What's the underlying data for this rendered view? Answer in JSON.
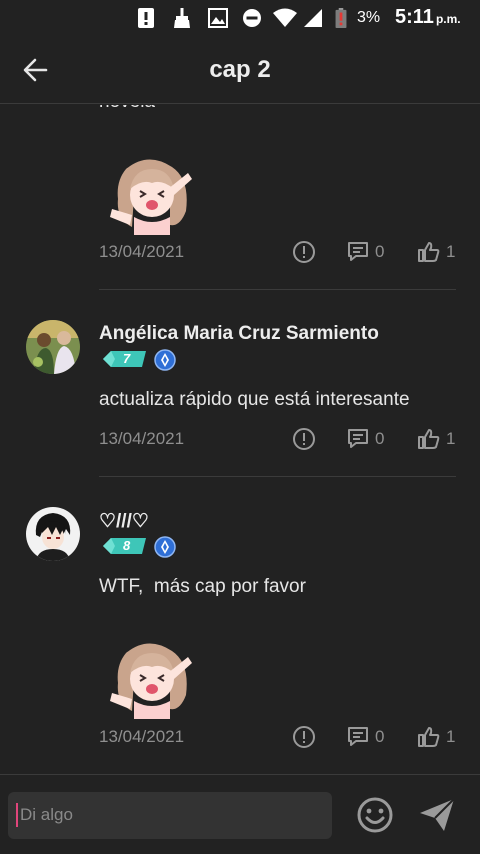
{
  "status_bar": {
    "battery_percent": "3%",
    "time": "5:11",
    "ampm": "p.m.",
    "icons": [
      "notification-alert-icon",
      "broom-icon",
      "image-icon",
      "do-not-disturb-icon",
      "wifi-icon",
      "signal-icon",
      "battery-low-icon"
    ]
  },
  "header": {
    "title": "cap 2",
    "back_icon": "arrow-left-icon"
  },
  "comments": [
    {
      "partial_text": "novela",
      "has_sticker": true,
      "date": "13/04/2021",
      "reply_count": "0",
      "like_count": "1"
    },
    {
      "author": "Angélica Maria Cruz Sarmiento",
      "level": "7",
      "text": "actualiza rápido que está interesante",
      "date": "13/04/2021",
      "reply_count": "0",
      "like_count": "1"
    },
    {
      "author": "♡///♡",
      "level": "8",
      "text": "WTF,  más cap por favor",
      "has_sticker": true,
      "date": "13/04/2021",
      "reply_count": "0",
      "like_count": "1"
    }
  ],
  "composer": {
    "placeholder": "Di algo",
    "emoji_icon": "smiley-icon",
    "send_icon": "send-icon"
  },
  "colors": {
    "background": "#222222",
    "level_badge": "#3ec6b8",
    "mod_badge": "#2f6fd6",
    "caret": "#e0457b"
  }
}
